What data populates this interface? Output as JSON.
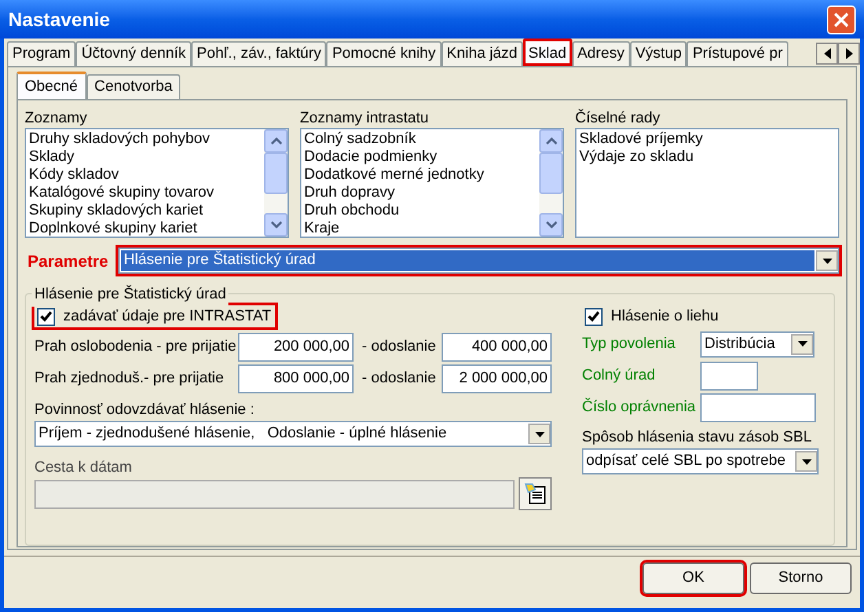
{
  "window": {
    "title": "Nastavenie"
  },
  "tabs": [
    {
      "label": "Program",
      "selected": false,
      "highlighted": false
    },
    {
      "label": "Účtovný denník",
      "selected": false,
      "highlighted": false
    },
    {
      "label": "Pohľ., záv., faktúry",
      "selected": false,
      "highlighted": false
    },
    {
      "label": "Pomocné knihy",
      "selected": false,
      "highlighted": false
    },
    {
      "label": "Kniha jázd",
      "selected": false,
      "highlighted": false
    },
    {
      "label": "Sklad",
      "selected": true,
      "highlighted": true
    },
    {
      "label": "Adresy",
      "selected": false,
      "highlighted": false
    },
    {
      "label": "Výstup",
      "selected": false,
      "highlighted": false
    },
    {
      "label": "Prístupové pr",
      "selected": false,
      "highlighted": false
    }
  ],
  "subtabs": [
    {
      "label": "Obecné",
      "selected": true
    },
    {
      "label": "Cenotvorba",
      "selected": false
    }
  ],
  "lists": [
    {
      "title": "Zoznamy",
      "kind": "scrolling",
      "items": [
        "Druhy skladových pohybov",
        "Sklady",
        "Kódy skladov",
        "Katalógové skupiny tovarov",
        "Skupiny skladových kariet",
        "Doplnkové skupiny kariet"
      ]
    },
    {
      "title": "Zoznamy intrastatu",
      "kind": "scrolling",
      "items": [
        "Colný sadzobník",
        "Dodacie podmienky",
        "Dodatkové merné jednotky",
        "Druh dopravy",
        "Druh obchodu",
        "Kraje"
      ]
    },
    {
      "title": "Číselné rady",
      "kind": "plain",
      "items": [
        "Skladové príjemky",
        "Výdaje zo skladu"
      ]
    }
  ],
  "parameters": {
    "label": "Parametre",
    "value": "Hlásenie pre Štatistický úrad",
    "highlighted": true
  },
  "intrastat": {
    "title": "Hlásenie pre Štatistický úrad",
    "checkbox": {
      "label": "zadávať údaje pre INTRASTAT",
      "checked": true,
      "highlighted": true
    },
    "thresholds": [
      {
        "label": "Prah oslobodenia - pre prijatie",
        "receive": "200 000,00",
        "send_label": "- odoslanie",
        "send": "400 000,00"
      },
      {
        "label": "Prah zjednoduš.- pre prijatie",
        "receive": "800 000,00",
        "send_label": "- odoslanie",
        "send": "2 000 000,00"
      }
    ],
    "obligation": {
      "label": "Povinnosť odovzdávať hlásenie :",
      "value": "Príjem - zjednodušené hlásenie,   Odoslanie - úplné hlásenie"
    },
    "data_path": {
      "label": "Cesta k dátam",
      "disabled": true
    }
  },
  "alcohol": {
    "checkbox": {
      "label": "Hlásenie o liehu",
      "checked": true
    },
    "fields": [
      {
        "kind": "dropdown",
        "label": "Typ povolenia",
        "value": "Distribúcia"
      },
      {
        "kind": "text",
        "label": "Colný úrad"
      },
      {
        "kind": "text",
        "label": "Číslo oprávnenia"
      }
    ],
    "method": {
      "label": "Spôsob hlásenia stavu zásob SBL",
      "value": "odpísať celé SBL po spotrebe"
    }
  },
  "buttons": [
    {
      "label": "OK",
      "highlighted": true
    },
    {
      "label": "Storno",
      "highlighted": false
    }
  ]
}
